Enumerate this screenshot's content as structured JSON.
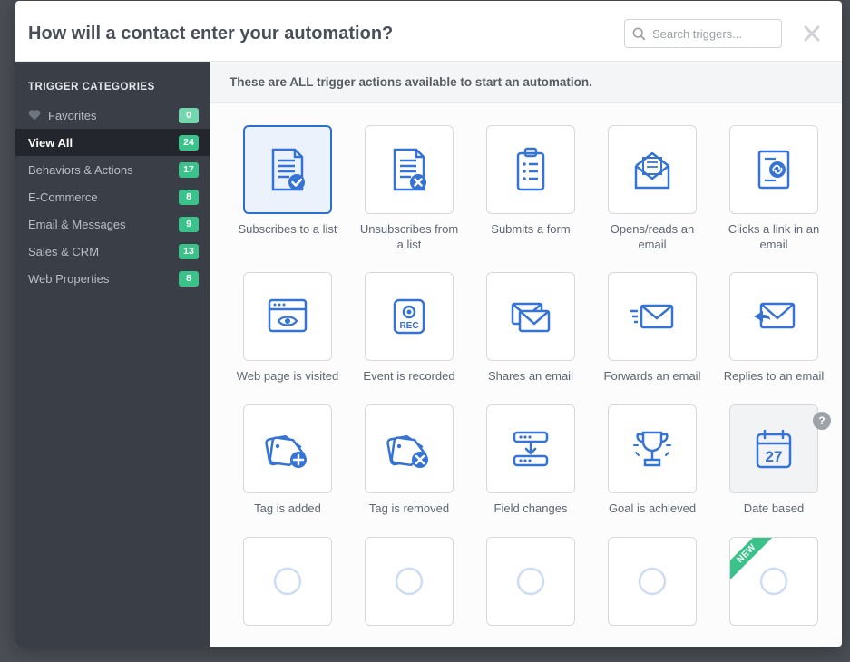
{
  "header": {
    "title": "How will a contact enter your automation?",
    "search_placeholder": "Search triggers..."
  },
  "sidebar": {
    "heading": "TRIGGER CATEGORIES",
    "items": [
      {
        "key": "favorites",
        "label": "Favorites",
        "count": 0,
        "has_icon": true,
        "muted": true
      },
      {
        "key": "view-all",
        "label": "View All",
        "count": 24,
        "active": true
      },
      {
        "key": "behaviors",
        "label": "Behaviors & Actions",
        "count": 17
      },
      {
        "key": "ecommerce",
        "label": "E-Commerce",
        "count": 8
      },
      {
        "key": "email",
        "label": "Email & Messages",
        "count": 9
      },
      {
        "key": "sales",
        "label": "Sales & CRM",
        "count": 13
      },
      {
        "key": "web",
        "label": "Web Properties",
        "count": 8
      }
    ]
  },
  "banner_text": "These are ALL trigger actions available to start an automation.",
  "help_tooltip": "?",
  "new_ribbon_text": "NEW",
  "triggers": [
    {
      "key": "subscribe",
      "label": "Subscribes to a list",
      "icon": "document-check",
      "selected": true
    },
    {
      "key": "unsubscribe",
      "label": "Unsubscribes from a list",
      "icon": "document-x"
    },
    {
      "key": "submit-form",
      "label": "Submits a form",
      "icon": "clipboard"
    },
    {
      "key": "open-email",
      "label": "Opens/reads an email",
      "icon": "envelope-open"
    },
    {
      "key": "click-link",
      "label": "Clicks a link in an email",
      "icon": "page-link"
    },
    {
      "key": "page-visit",
      "label": "Web page is visited",
      "icon": "browser-eye"
    },
    {
      "key": "event",
      "label": "Event is recorded",
      "icon": "record"
    },
    {
      "key": "share-email",
      "label": "Shares an email",
      "icon": "envelopes"
    },
    {
      "key": "forward-email",
      "label": "Forwards an email",
      "icon": "envelope-forward"
    },
    {
      "key": "reply-email",
      "label": "Replies to an email",
      "icon": "envelope-reply"
    },
    {
      "key": "tag-added",
      "label": "Tag is added",
      "icon": "tag-plus"
    },
    {
      "key": "tag-removed",
      "label": "Tag is removed",
      "icon": "tag-x"
    },
    {
      "key": "field-change",
      "label": "Field changes",
      "icon": "fields-down"
    },
    {
      "key": "goal",
      "label": "Goal is achieved",
      "icon": "trophy"
    },
    {
      "key": "date-based",
      "label": "Date based",
      "icon": "calendar-27",
      "hovered": true
    },
    {
      "key": "p16",
      "label": "",
      "icon": "blank"
    },
    {
      "key": "p17",
      "label": "",
      "icon": "blank"
    },
    {
      "key": "p18",
      "label": "",
      "icon": "blank"
    },
    {
      "key": "p19",
      "label": "",
      "icon": "blank"
    },
    {
      "key": "p20",
      "label": "",
      "icon": "blank",
      "new": true
    }
  ]
}
